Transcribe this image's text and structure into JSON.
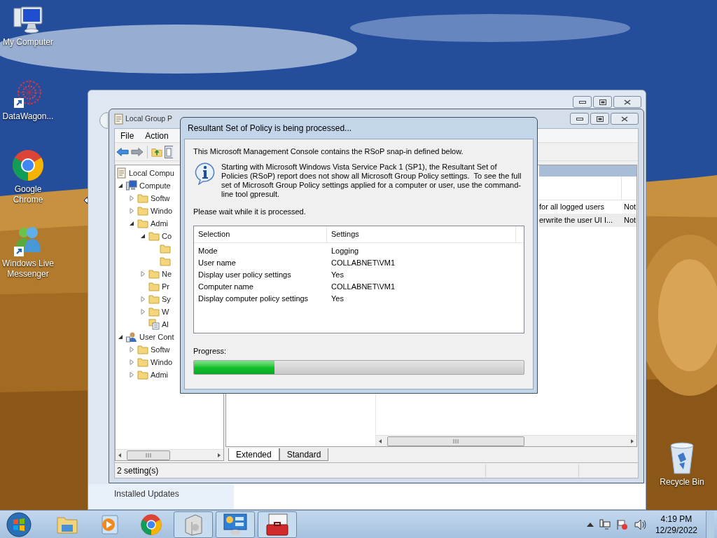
{
  "desktop_icons": [
    {
      "label": "My Computer",
      "kind": "computer"
    },
    {
      "label": "DataWagon...",
      "kind": "datawagon"
    },
    {
      "label": "Google Chrome",
      "kind": "chrome"
    },
    {
      "label": "Windows Live Messenger",
      "kind": "messenger"
    },
    {
      "label": "Recycle Bin",
      "kind": "recycle"
    }
  ],
  "back_window": {
    "sidebar_link": "Installed Updates"
  },
  "editor": {
    "title": "Local Group P",
    "menu": [
      "File",
      "Action"
    ],
    "tree": [
      {
        "label": "Local Compu",
        "kind": "policy",
        "children": [
          {
            "label": "Compute",
            "kind": "computer",
            "expandable": true,
            "expanded": true,
            "children": [
              {
                "label": "Softw",
                "kind": "folder",
                "expandable": true,
                "expanded": false
              },
              {
                "label": "Windo",
                "kind": "folder",
                "expandable": true,
                "expanded": false
              },
              {
                "label": "Admi",
                "kind": "folder",
                "expandable": true,
                "expanded": true,
                "children": [
                  {
                    "label": "Co",
                    "kind": "folder",
                    "expandable": true,
                    "expanded": true,
                    "children": [
                      {
                        "kind": "folder",
                        "expandable": false
                      },
                      {
                        "kind": "folder",
                        "expandable": false
                      }
                    ]
                  },
                  {
                    "label": "Ne",
                    "kind": "folder",
                    "expandable": true,
                    "expanded": false
                  },
                  {
                    "label": "Pr",
                    "kind": "folder",
                    "expandable": false
                  },
                  {
                    "label": "Sy",
                    "kind": "folder",
                    "expandable": true,
                    "expanded": false
                  },
                  {
                    "label": "W",
                    "kind": "folder",
                    "expandable": true,
                    "expanded": false
                  },
                  {
                    "label": "Al",
                    "kind": "settings",
                    "expandable": false
                  }
                ]
              }
            ]
          },
          {
            "label": "User Cont",
            "kind": "user",
            "expandable": true,
            "expanded": true,
            "children": [
              {
                "label": "Softw",
                "kind": "folder",
                "expandable": true,
                "expanded": false
              },
              {
                "label": "Windo",
                "kind": "folder",
                "expandable": true,
                "expanded": false
              },
              {
                "label": "Admi",
                "kind": "folder",
                "expandable": true,
                "expanded": false
              }
            ]
          }
        ]
      }
    ],
    "list_rows": [
      {
        "setting": "for all logged users",
        "state": "Not",
        "selected": false
      },
      {
        "setting": "erwrite the user UI I...",
        "state": "Not",
        "selected": true
      }
    ],
    "view_tabs": [
      {
        "label": "Extended",
        "selected": true
      },
      {
        "label": "Standard",
        "selected": false
      }
    ],
    "status_bar": "2 setting(s)"
  },
  "dialog": {
    "title": "Resultant Set of Policy is being processed...",
    "intro": "This Microsoft Management Console contains the RSoP snap-in defined below.",
    "notice": "Starting with Microsoft Windows Vista Service Pack 1 (SP1), the Resultant Set of Policies (RSoP) report does not show all Microsoft Group Policy settings.  To see the full set of Microsoft Group Policy settings applied for a computer or user, use the command-line tool gpresult.",
    "wait": "Please wait while it is processed.",
    "columns": [
      "Selection",
      "Settings"
    ],
    "rows": [
      {
        "selection": "Mode",
        "settings": "Logging"
      },
      {
        "selection": "User name",
        "settings": "COLLABNET\\VM1"
      },
      {
        "selection": "Display user policy settings",
        "settings": "Yes"
      },
      {
        "selection": "Computer name",
        "settings": "COLLABNET\\VM1"
      },
      {
        "selection": "Display computer policy settings",
        "settings": "Yes"
      }
    ],
    "progress_label": "Progress:",
    "progress": {
      "level": 0.245
    }
  },
  "taskbar": {
    "items": [
      {
        "kind": "explorer",
        "running": false
      },
      {
        "kind": "media",
        "running": false
      },
      {
        "kind": "chrome",
        "running": false
      },
      {
        "kind": "installer",
        "running": true
      },
      {
        "kind": "control-panel",
        "running": true
      },
      {
        "kind": "toolbox",
        "running": true
      }
    ],
    "clock": {
      "time": "4:19 PM",
      "date": "12/29/2022"
    }
  }
}
